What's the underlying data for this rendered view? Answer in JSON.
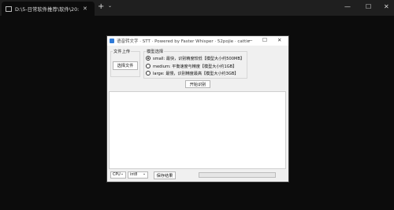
{
  "terminal": {
    "tab_title": "D:\\5-日常软件推荐\\软件\\20:",
    "close_glyph": "✕",
    "add_glyph": "+",
    "dropdown_glyph": "⌄",
    "min_glyph": "—",
    "max_glyph": "☐",
    "close_window_glyph": "✕"
  },
  "app": {
    "title": "语音转文字 · STT · Powered by Faster Whisper · 52pojie · cattie",
    "min_glyph": "—",
    "max_glyph": "☐",
    "close_glyph": "✕",
    "file_group_label": "文件上传",
    "select_file_button": "选择文件",
    "model_group_label": "模型选择",
    "models": [
      {
        "label": "small: 最快，识别精度较低【模型大小约500MB】",
        "checked": true
      },
      {
        "label": "medium: 平衡速度与精度【模型大小约1GB】",
        "checked": false
      },
      {
        "label": "large: 最慢，识别精度最高【模型大小约3GB】",
        "checked": false
      }
    ],
    "start_button": "开始识别",
    "device_select": "CPU",
    "compute_select": "int8",
    "save_button": "保存结果",
    "progress_fraction": 0,
    "progress_color": "#06b025"
  }
}
